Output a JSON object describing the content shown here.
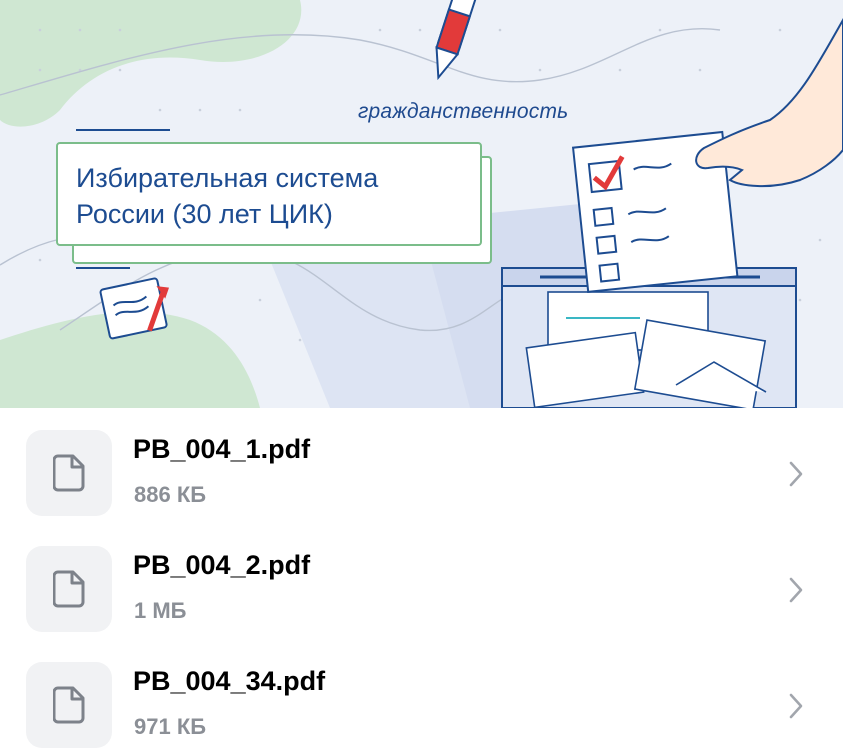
{
  "banner": {
    "tag": "гражданственность",
    "title_line1": "Избирательная система",
    "title_line2": "России (30 лет ЦИК)"
  },
  "files": [
    {
      "name": "PB_004_1.pdf",
      "size": "886 КБ"
    },
    {
      "name": "PB_004_2.pdf",
      "size": "1 МБ"
    },
    {
      "name": "PB_004_34.pdf",
      "size": "971 КБ"
    }
  ],
  "colors": {
    "title_text": "#1d4c91",
    "card_border": "#7bbd8a",
    "file_size_text": "#8b8f96",
    "icon_tile": "#f1f2f4"
  },
  "icons": {
    "file": "file-icon",
    "chevron": "chevron-right-icon"
  }
}
